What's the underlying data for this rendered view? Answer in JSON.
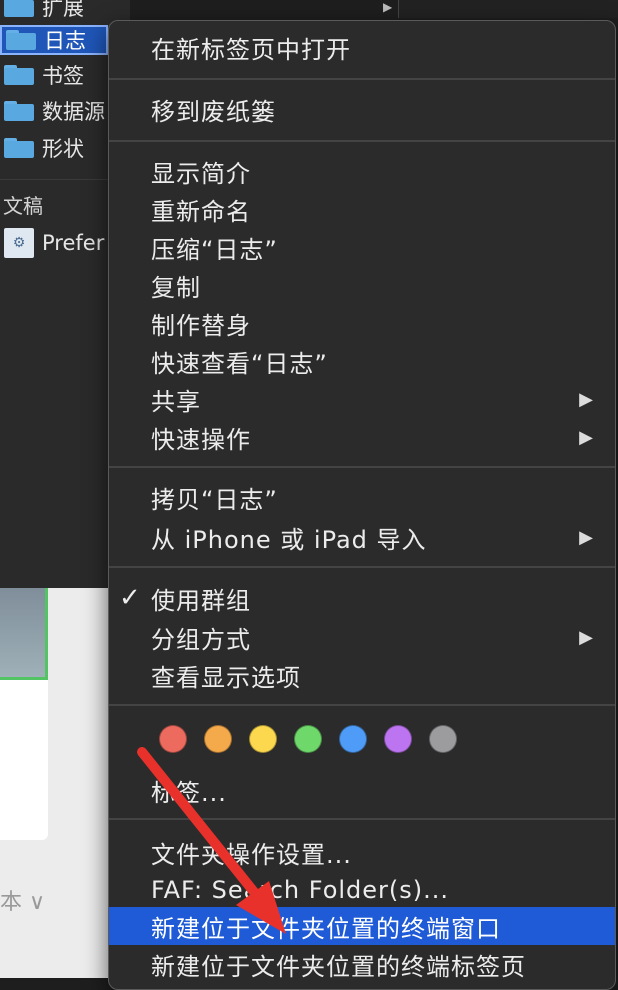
{
  "sidebar": {
    "items": [
      {
        "label": "扩展",
        "icon": "folder-icon"
      },
      {
        "label": "日志",
        "icon": "folder-icon",
        "selected": true
      },
      {
        "label": "书签",
        "icon": "folder-icon"
      },
      {
        "label": "数据源",
        "icon": "folder-icon"
      },
      {
        "label": "形状",
        "icon": "folder-icon"
      }
    ],
    "section_header": "文稿",
    "document_item": {
      "label": "Prefer",
      "icon": "preferences-file-icon"
    }
  },
  "lower_pane": {
    "text": "本 ∨"
  },
  "menu": {
    "groups": [
      [
        {
          "label": "在新标签页中打开"
        }
      ],
      [
        {
          "label": "移到废纸篓"
        }
      ],
      [
        {
          "label": "显示简介"
        },
        {
          "label": "重新命名"
        },
        {
          "label": "压缩“日志”"
        },
        {
          "label": "复制"
        },
        {
          "label": "制作替身"
        },
        {
          "label": "快速查看“日志”"
        },
        {
          "label": "共享",
          "submenu": true
        },
        {
          "label": "快速操作",
          "submenu": true
        }
      ],
      [
        {
          "label": "拷贝“日志”"
        },
        {
          "label": "从 iPhone 或 iPad 导入",
          "submenu": true
        }
      ],
      [
        {
          "label": "使用群组",
          "checked": true
        },
        {
          "label": "分组方式",
          "submenu": true
        },
        {
          "label": "查看显示选项"
        }
      ],
      [
        {
          "label": "标签..."
        }
      ],
      [
        {
          "label": "文件夹操作设置..."
        },
        {
          "label": "FAF: Search Folder(s)..."
        },
        {
          "label": "新建位于文件夹位置的终端窗口",
          "highlighted": true
        },
        {
          "label": "新建位于文件夹位置的终端标签页"
        }
      ]
    ],
    "tag_colors": [
      "#ec6a5e",
      "#f4a94a",
      "#fbd84e",
      "#6ed86b",
      "#4f9cf8",
      "#bd74f0",
      "#9c9c9e"
    ],
    "submenu_arrow": "▶",
    "checkmark": "✓"
  },
  "annotation": {
    "arrow_color": "#e8312a"
  }
}
